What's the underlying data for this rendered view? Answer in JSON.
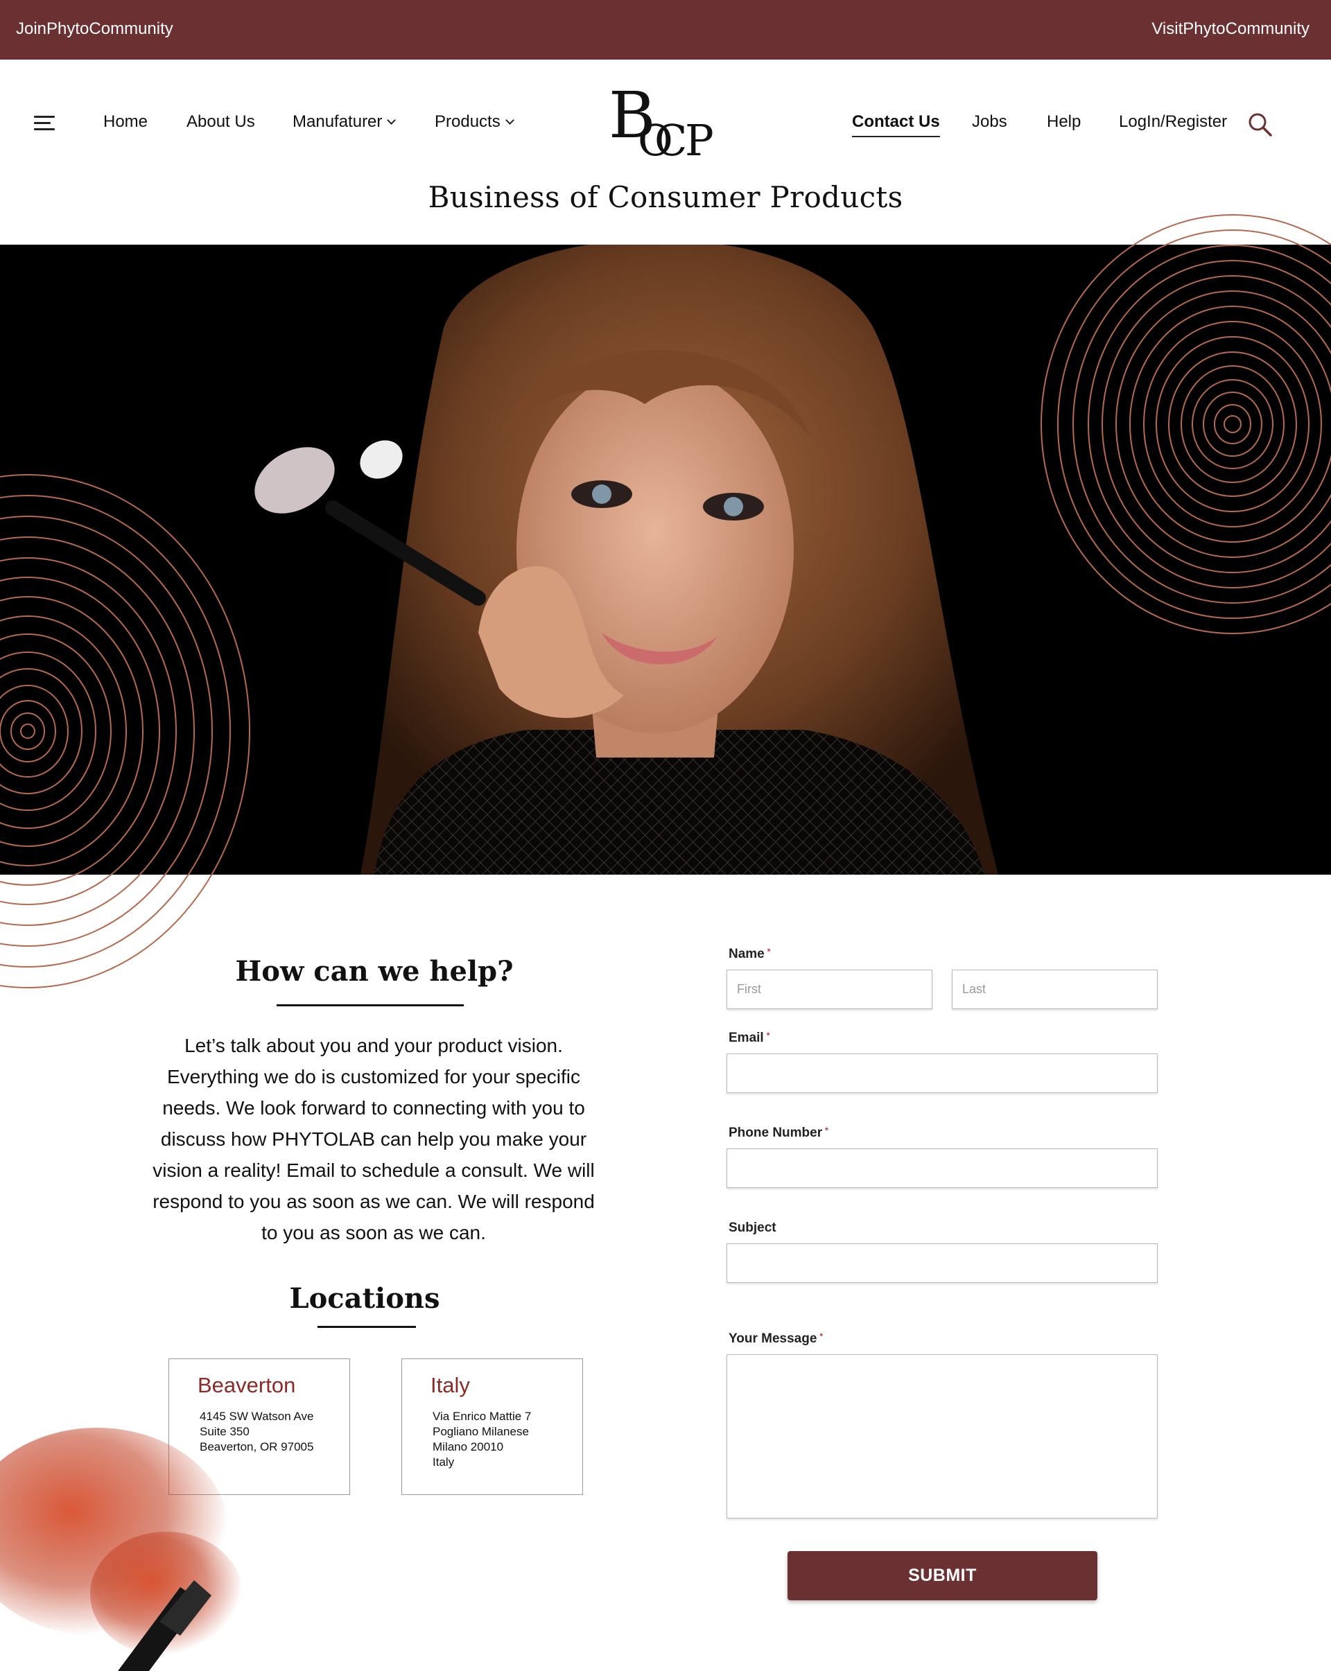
{
  "topbar": {
    "left_link": "JoinPhytoCommunity",
    "right_link": "VisitPhytoCommunity",
    "background": "#6a3032"
  },
  "nav": {
    "menu_icon": "hamburger-menu-icon",
    "items": [
      {
        "label": "Home"
      },
      {
        "label": "About Us"
      },
      {
        "label": "Manufaturer",
        "has_dropdown": true
      },
      {
        "label": "Products",
        "has_dropdown": true
      },
      {
        "label": "Contact Us",
        "active": true
      },
      {
        "label": "Jobs"
      },
      {
        "label": "Help"
      },
      {
        "label": "LogIn/Register"
      }
    ],
    "search_icon": "search-icon",
    "accent": "#6a3032"
  },
  "logo": {
    "letters": "BOCP"
  },
  "brand": {
    "tagline": "Business of Consumer Products"
  },
  "help": {
    "title": "How can we help?",
    "body": "Let’s talk about you and your product vision. Everything we do is customized for your specific needs. We look forward to connecting with you to discuss how PHYTOLAB can help you make your vision a reality!  Email to schedule a consult.  We will respond to you as soon as we can. We will respond to you as soon as we can."
  },
  "locations": {
    "title": "Locations",
    "cards": [
      {
        "name": "Beaverton",
        "address": "4145 SW Watson Ave\nSuite 350\nBeaverton, OR 97005"
      },
      {
        "name": "Italy",
        "address": "Via Enrico Mattie 7\nPogliano Milanese\nMilano 20010\nItaly"
      }
    ],
    "name_color": "#8e2a25"
  },
  "form": {
    "name_label": "Name",
    "first_placeholder": "First",
    "last_placeholder": "Last",
    "email_label": "Email",
    "phone_label": "Phone Number",
    "subject_label": "Subject",
    "message_label": "Your Message",
    "required_mark": "*",
    "submit_label": "SUBMIT"
  }
}
